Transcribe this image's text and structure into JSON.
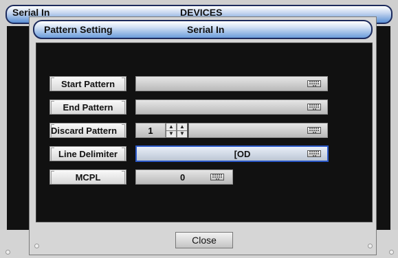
{
  "background_window": {
    "title_left": "Serial In",
    "title_center": "DEVICES"
  },
  "dialog": {
    "title_left": "Pattern Setting",
    "title_center": "Serial In"
  },
  "rows": {
    "start_pattern": {
      "label": "Start Pattern",
      "value": ""
    },
    "end_pattern": {
      "label": "End Pattern",
      "value": ""
    },
    "discard_pattern": {
      "label": "Discard Pattern",
      "count": "1",
      "value": ""
    },
    "line_delimiter": {
      "label": "Line Delimiter",
      "value": "[OD"
    },
    "mcpl": {
      "label": "MCPL",
      "value": "0"
    }
  },
  "buttons": {
    "close_label": "Close"
  },
  "icons": {
    "keyboard": "keyboard-icon",
    "spin_up": "arrow-up-icon",
    "spin_down": "arrow-down-icon"
  },
  "colors": {
    "title_bar_border": "#1c2a5c",
    "title_bar_gradient_end": "#6b9ddb",
    "active_field_border": "#2a58c8",
    "panel_background": "#111111"
  }
}
